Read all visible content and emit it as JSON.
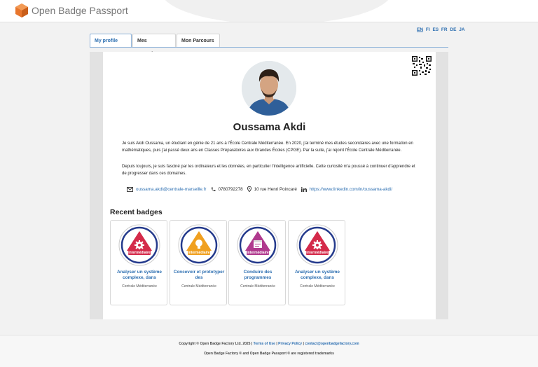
{
  "header": {
    "app_title": "Open Badge Passport",
    "logo_icon": "hexagon-box-icon",
    "brand_color": "#e8762d"
  },
  "languages": {
    "items": [
      "EN",
      "FI",
      "ES",
      "FR",
      "DE",
      "JA"
    ],
    "active": "EN"
  },
  "tabs": [
    {
      "label": "My profile",
      "active": true
    },
    {
      "label": "Mes compéte...",
      "active": false
    },
    {
      "label": "Mon Parcours",
      "active": false
    }
  ],
  "profile": {
    "name": "Oussama Akdi",
    "bio_1": "Je suis Akdi Oussama, un étudiant en génie de 21 ans à l'École Centrale Méditerranée. En 2020, j'ai terminé mes études secondaires avec une formation en mathématiques, puis j'ai passé deux ans en Classes Préparatoires aux Grandes Écoles (CPGE). Par la suite, j'ai rejoint l'École Centrale Méditerranée.",
    "bio_2": "Depuis toujours, je suis fasciné par les ordinateurs et les données, en particulier l'intelligence artificielle. Cette curiosité m'a poussé à continuer d'apprendre et de progresser dans ces domaines.",
    "email": "oussama.akdi@centrale-marseille.fr",
    "phone": "0780792278",
    "address": "10 rue Henri Poincaré",
    "linkedin": "https://www.linkedin.com/in/oussama-akdi/"
  },
  "recent_badges": {
    "heading": "Recent badges",
    "items": [
      {
        "title": "Analyser un système complexe, dans",
        "issuer": "Centrale Méditerranée",
        "level": "intermédiaire",
        "icon": "gear-icon",
        "color": "#d42a4a"
      },
      {
        "title": "Concevoir et prototyper des",
        "issuer": "Centrale Méditerranée",
        "level": "intermédiaire",
        "icon": "lightbulb-icon",
        "color": "#f0a020"
      },
      {
        "title": "Conduire des programmes",
        "issuer": "Centrale Méditerranée",
        "level": "intermédiaire",
        "icon": "calendar-icon",
        "color": "#b03a8e"
      },
      {
        "title": "Analyser un système complexe, dans",
        "issuer": "Centrale Méditerranée",
        "level": "intermédiaire",
        "icon": "gear-icon",
        "color": "#d42a4a"
      }
    ]
  },
  "footer": {
    "copyright": "Copyright © Open Badge Factory Ltd. 2025",
    "terms": "Terms of Use",
    "privacy": "Privacy Policy",
    "contact": "contact@openbadgefactory.com",
    "trademarks": "Open Badge Factory ® and Open Badge Passport ® are registered trademarks"
  }
}
